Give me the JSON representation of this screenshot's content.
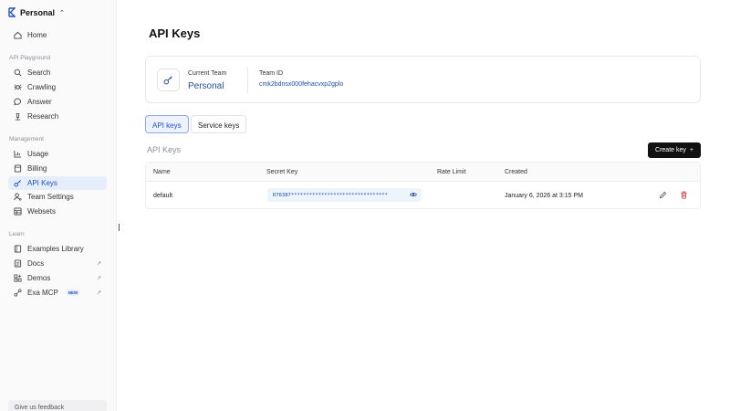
{
  "sidebar": {
    "workspace_name": "Personal",
    "home": "Home",
    "sections": {
      "playground": "API Playground",
      "management": "Management",
      "learn": "Learn"
    },
    "playground_items": [
      "Search",
      "Crawling",
      "Answer",
      "Research"
    ],
    "management_items": [
      "Usage",
      "Billing",
      "API Keys",
      "Team Settings",
      "Websets"
    ],
    "learn_items": [
      "Examples Library",
      "Docs",
      "Demos",
      "Exa MCP"
    ],
    "new_badge": "NEW",
    "feedback": "Give us feedback",
    "active_item": "API Keys"
  },
  "main": {
    "title": "API Keys",
    "team_card": {
      "current_team_label": "Current Team",
      "current_team_value": "Personal",
      "team_id_label": "Team ID",
      "team_id_value": "cmk2bdnsx000fehacvxp2gplo"
    },
    "tabs": {
      "api_keys": "API keys",
      "service_keys": "Service keys"
    },
    "section_title": "API Keys",
    "create_button": "Create key",
    "table": {
      "headers": {
        "name": "Name",
        "secret": "Secret Key",
        "rate": "Rate Limit",
        "created": "Created"
      },
      "rows": [
        {
          "name": "default",
          "secret": "R76387********************************",
          "rate_limit": "",
          "created": "January 6, 2026 at 3:15 PM"
        }
      ]
    }
  },
  "colors": {
    "accent": "#1f4fd1",
    "active_bg": "#e6eefc",
    "delete": "#d33a3a"
  }
}
